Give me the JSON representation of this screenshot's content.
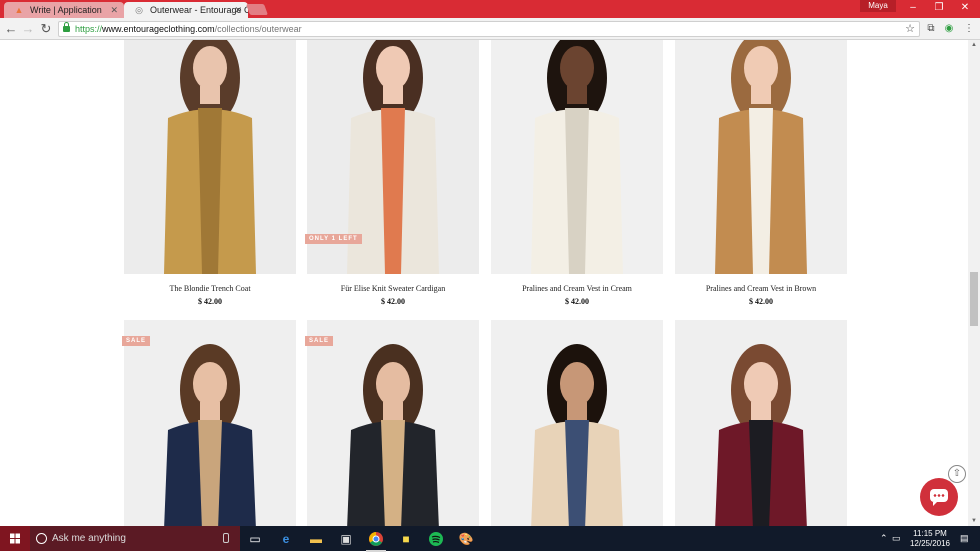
{
  "browser": {
    "tabs": [
      {
        "title": "Write | Application",
        "active": false,
        "icon": "flame-icon"
      },
      {
        "title": "Outerwear - Entourage C",
        "active": true,
        "icon": "globe-icon"
      }
    ],
    "user": "Maya",
    "url": {
      "scheme": "https://",
      "host": "www.entourageclothing.com",
      "path": "/collections/outerwear"
    }
  },
  "products": [
    {
      "name": "The Blondie Trench Coat",
      "price": "$ 42.00",
      "badge": "",
      "colors": {
        "bg": "#ececec",
        "main": "#c59a4c",
        "accent": "#a07836",
        "skin": "#e9c4ad",
        "hair": "#5a3c2a"
      }
    },
    {
      "name": "Für Elise Knit Sweater Cardigan",
      "price": "$ 42.00",
      "badge": "ONLY 1 LEFT",
      "colors": {
        "bg": "#ececec",
        "main": "#ebe6dc",
        "accent": "#e07a4f",
        "skin": "#efc9b4",
        "hair": "#4a2f22"
      }
    },
    {
      "name": "Pralines and Cream Vest in Cream",
      "price": "$ 42.00",
      "badge": "",
      "colors": {
        "bg": "#f0f0f0",
        "main": "#f3efe5",
        "accent": "#d8d2c4",
        "skin": "#6b4430",
        "hair": "#1e140e"
      }
    },
    {
      "name": "Pralines and Cream Vest in Brown",
      "price": "$ 42.00",
      "badge": "",
      "colors": {
        "bg": "#efefef",
        "main": "#c28c50",
        "accent": "#f3eee4",
        "skin": "#f0cbb4",
        "hair": "#9b6a3f"
      }
    },
    {
      "name": "",
      "price": "",
      "badge": "SALE",
      "colors": {
        "bg": "#efefef",
        "main": "#1e2b4a",
        "accent": "#c9a57c",
        "skin": "#e7bfa4",
        "hair": "#5a3a25"
      }
    },
    {
      "name": "",
      "price": "",
      "badge": "SALE",
      "colors": {
        "bg": "#efefef",
        "main": "#22252b",
        "accent": "#d4b185",
        "skin": "#e5bca1",
        "hair": "#4a3020"
      }
    },
    {
      "name": "",
      "price": "",
      "badge": "",
      "colors": {
        "bg": "#f0f0f0",
        "main": "#e8d3b8",
        "accent": "#3c4f74",
        "skin": "#c79777",
        "hair": "#1c120c"
      }
    },
    {
      "name": "",
      "price": "",
      "badge": "",
      "colors": {
        "bg": "#efefef",
        "main": "#6e1828",
        "accent": "#1c1c22",
        "skin": "#efcab5",
        "hair": "#7a4a32"
      }
    }
  ],
  "taskbar": {
    "search_placeholder": "Ask me anything",
    "time": "11:15 PM",
    "date": "12/25/2016"
  },
  "colors": {
    "chrome_red": "#d92b34",
    "brand_accent": "#d0303b",
    "badge": "#e8a79a"
  }
}
